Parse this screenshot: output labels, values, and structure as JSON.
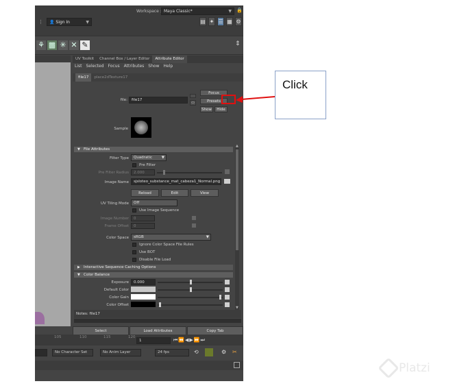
{
  "workspace": {
    "label": "Workspace :",
    "value": "Maya Classic*"
  },
  "signin": {
    "label": "Sign In"
  },
  "attr_editor": {
    "tabs": [
      "UV Toolkit",
      "Channel Box / Layer Editor",
      "Attribute Editor"
    ],
    "menu": [
      "List",
      "Selected",
      "Focus",
      "Attributes",
      "Show",
      "Help"
    ],
    "node_tabs": [
      "file17",
      "place2dTexture17"
    ],
    "file_label": "file:",
    "file_value": "file17",
    "focus": "Focus",
    "presets": "Presets",
    "show": "Show",
    "hide": "Hide",
    "sample_label": "Sample",
    "file_attributes": "File Attributes",
    "filter_type_label": "Filter Type",
    "filter_type_value": "Quadratic",
    "pre_filter": "Pre Filter",
    "pre_filter_radius_label": "Pre Filter Radius",
    "pre_filter_radius_value": "2.000",
    "image_name_label": "Image Name",
    "image_name_value": "sjsloteo_substance_mat_cabeza1_Normal.png",
    "reload": "Reload",
    "edit": "Edit",
    "view": "View",
    "uv_tiling_label": "UV Tiling Mode",
    "uv_tiling_value": "Off",
    "use_image_sequence": "Use Image Sequence",
    "image_number_label": "Image Number",
    "image_number_value": "0",
    "frame_offset_label": "Frame Offset",
    "frame_offset_value": "0",
    "color_space_label": "Color Space",
    "color_space_value": "sRGB",
    "ignore_color_space": "Ignore Color Space File Rules",
    "use_bot": "Use BOT",
    "disable_file_load": "Disable File Load",
    "interactive_caching": "Interactive Sequence Caching Options",
    "color_balance": "Color Balance",
    "exposure_label": "Exposure",
    "exposure_value": "0.000",
    "default_color_label": "Default Color",
    "color_gain_label": "Color Gain",
    "color_offset_label": "Color Offset",
    "notes": "Notes: file17",
    "select": "Select",
    "load_attributes": "Load Attributes",
    "copy_tab": "Copy Tab"
  },
  "timeline": {
    "ticks": [
      "105",
      "110",
      "115",
      "120"
    ],
    "current_frame": "1"
  },
  "range_bar": {
    "character_set": "No Character Set",
    "anim_layer": "No Anim Layer",
    "fps": "24 fps"
  },
  "annotation": {
    "text": "Click"
  },
  "watermark": {
    "text": "Platzi"
  },
  "colors": {
    "highlight": "#e01010",
    "panel": "#444444",
    "field": "#2b2b2b"
  }
}
